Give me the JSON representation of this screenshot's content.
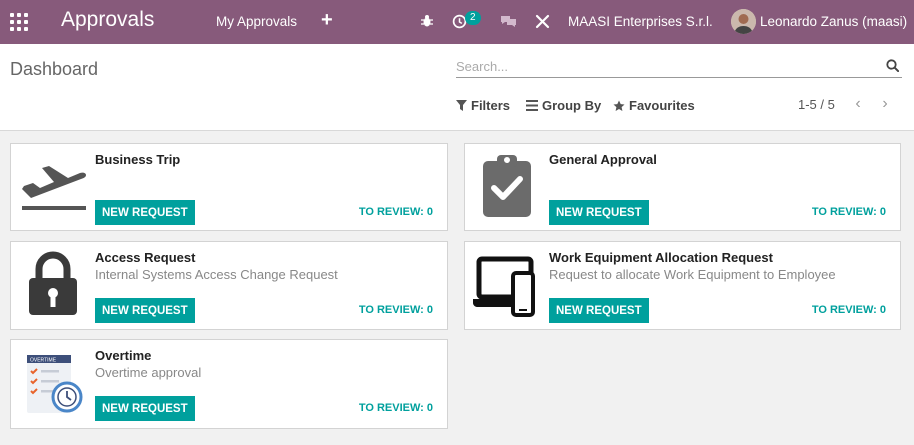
{
  "navbar": {
    "app_title": "Approvals",
    "menu_my_approvals": "My Approvals",
    "menu_add": "+",
    "activity_count": "2",
    "company": "MAASI Enterprises S.r.l.",
    "user": "Leonardo Zanus (maasi)",
    "accent_color": "#875a7b"
  },
  "control": {
    "breadcrumb": "Dashboard",
    "search_placeholder": "Search...",
    "filters": "Filters",
    "group_by": "Group By",
    "favourites": "Favourites",
    "pager": "1-5 / 5"
  },
  "cards": [
    {
      "title": "Business Trip",
      "description": "",
      "button": "NEW REQUEST",
      "review": "TO REVIEW: 0",
      "icon": "airplane-icon"
    },
    {
      "title": "General Approval",
      "description": "",
      "button": "NEW REQUEST",
      "review": "TO REVIEW: 0",
      "icon": "clipboard-check-icon"
    },
    {
      "title": "Access Request",
      "description": "Internal Systems Access Change Request",
      "button": "NEW REQUEST",
      "review": "TO REVIEW: 0",
      "icon": "padlock-icon"
    },
    {
      "title": "Work Equipment Allocation Request",
      "description": "Request to allocate Work Equipment to Employee",
      "button": "NEW REQUEST",
      "review": "TO REVIEW: 0",
      "icon": "laptop-phone-icon"
    },
    {
      "title": "Overtime",
      "description": "Overtime approval",
      "button": "NEW REQUEST",
      "review": "TO REVIEW: 0",
      "icon": "overtime-clock-icon",
      "icon_label": "OVERTIME"
    }
  ]
}
